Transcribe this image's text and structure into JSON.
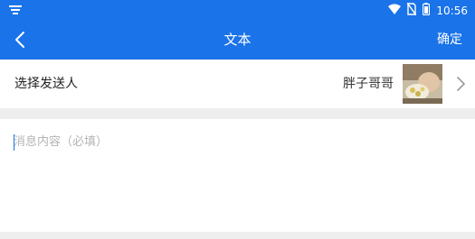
{
  "status_bar": {
    "time": "10:56",
    "icons": [
      "notification-icon",
      "wifi-icon",
      "no-sim-icon",
      "battery-icon"
    ]
  },
  "app_bar": {
    "title": "文本",
    "confirm_label": "确定",
    "back_icon": "back-arrow-icon"
  },
  "sender": {
    "label": "选择发送人",
    "name": "胖子哥哥",
    "chevron_icon": "chevron-right-icon"
  },
  "message": {
    "placeholder": "消息内容（必填）",
    "value": ""
  },
  "colors": {
    "accent": "#1a73e8",
    "divider": "#eeeeee",
    "placeholder": "#b4b4b4"
  }
}
